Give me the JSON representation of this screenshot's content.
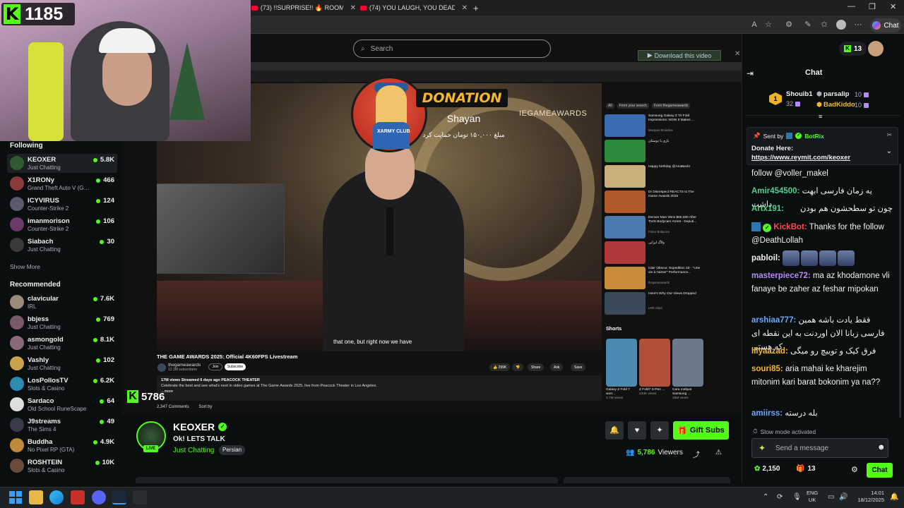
{
  "browser": {
    "tabs": [
      {
        "label": "(73) !!SURPRISE!! 🔥 ROOM TOUR"
      },
      {
        "label": "(74) YOU LAUGH, YOU DEAD! ❌"
      }
    ],
    "new_tab_icon": "plus-icon",
    "chat_button_label": "Chat",
    "search_placeholder": "Search",
    "download_button_label": "Download this video"
  },
  "webcam_overlay": {
    "kick_count": "1185"
  },
  "sidebar": {
    "following_heading": "Following",
    "following": [
      {
        "name": "KEOXER",
        "category": "Just Chatting",
        "viewers": "5.8K",
        "color": "#2f5a32"
      },
      {
        "name": "X1RONy",
        "category": "Grand Theft Auto V (G…",
        "viewers": "466",
        "color": "#8a3a3a"
      },
      {
        "name": "ICYVIRUS",
        "category": "Counter-Strike 2",
        "viewers": "124",
        "color": "#5a5a6a"
      },
      {
        "name": "imanmorison",
        "category": "Counter-Strike 2",
        "viewers": "106",
        "color": "#6a3a6a"
      },
      {
        "name": "Siabach",
        "category": "Just Chatting",
        "viewers": "30",
        "color": "#3a3a3a"
      }
    ],
    "show_more_label": "Show More",
    "recommended_heading": "Recommended",
    "recommended": [
      {
        "name": "clavicular",
        "category": "IRL",
        "viewers": "7.6K",
        "color": "#9a8a7a"
      },
      {
        "name": "bbjess",
        "category": "Just Chatting",
        "viewers": "769",
        "color": "#7a5a6a"
      },
      {
        "name": "asmongold",
        "category": "Just Chatting",
        "viewers": "8.1K",
        "color": "#8a6a7a"
      },
      {
        "name": "Vashly",
        "category": "Just Chatting",
        "viewers": "102",
        "color": "#c9a24a"
      },
      {
        "name": "LosPollosTV",
        "category": "Slots & Casino",
        "viewers": "6.2K",
        "color": "#2a8ab0"
      },
      {
        "name": "Sardaco",
        "category": "Old School RuneScape",
        "viewers": "64",
        "color": "#dddddd"
      },
      {
        "name": "J9streams",
        "category": "The Sims 4",
        "viewers": "49",
        "color": "#3a3a4a"
      },
      {
        "name": "Buddha",
        "category": "No Pixel RP (GTA)",
        "viewers": "4.9K",
        "color": "#c08a3a"
      },
      {
        "name": "ROSHTEIN",
        "category": "Slots & Casino",
        "viewers": "10K",
        "color": "#6a4a3a"
      }
    ]
  },
  "video": {
    "event_label": "IEGAMEAWARDS",
    "subtitle": "that one, but right now we have",
    "title": "THE GAME AWARDS 2025: Official 4K60FPS Livestream",
    "channel": "thegameawards",
    "channel_subs": "12.3M subscribers",
    "join_label": "Join",
    "subscribe_label": "Subscribe",
    "likes": "299K",
    "share_label": "Share",
    "ask_label": "Ask",
    "save_label": "Save",
    "description_line1": "17M views  Streamed 6 days ago  PEACOCK THEATER",
    "description_line2": "Celebrate the best and see what's next in video games at The Game Awards 2025, live from Peacock Theater in Los Angeles.",
    "description_more": "...more",
    "comments_label": "2,347 Comments",
    "sort_label": "Sort by",
    "filters": [
      "All",
      "From your search",
      "From thegameawards"
    ],
    "recommendations": [
      {
        "title": "Samsung Galaxy Z Tri Fold Impressions: NOW It Makes ...",
        "meta": "Marques Brownlee",
        "color": "#3a6ab0"
      },
      {
        "title": "بازی با دوستان",
        "meta": "",
        "color": "#2c8a3a"
      },
      {
        "title": "Happy birthday @AriaBeckr",
        "meta": "",
        "color": "#c9b07a"
      },
      {
        "title": "Dr Disrespect REACTS to The Game Awards 2025",
        "meta": "",
        "color": "#b05a2a"
      },
      {
        "title": "Denver Man Wins $80,000 After THIS Bodycam Arrest - Deputi...",
        "meta": "Police Bodycam",
        "color": "#4a7ab0"
      },
      {
        "title": "ولاگ ایرانی",
        "meta": "",
        "color": "#b03a3a"
      },
      {
        "title": "Clair Obscur: Expedition 33 - \"Une vie à t'aimer\" Performance...",
        "meta": "thegameawards",
        "color": "#c98a3a"
      },
      {
        "title": "Here's Why Our Views Dropped",
        "meta": "LMG Clips",
        "color": "#3a4a5a"
      }
    ],
    "shorts_label": "Shorts",
    "shorts": [
      {
        "title": "Galaxy Z Fold 7 wort...",
        "views": "3.7M views",
        "color": "#4a8ab0"
      },
      {
        "title": "Z Fold7 S-Pen ...",
        "views": "233K views",
        "color": "#b0503a"
      },
      {
        "title": "Cara melipat Samsung ...",
        "views": "28M views",
        "color": "#6a7a8a"
      }
    ]
  },
  "donation_alert": {
    "banner": "DONATION",
    "donor": "Shayan",
    "amount_text": "مبلغ ۱۵۰,۰۰۰ تومان حمایت کرد",
    "club_label": "XARMY CLUB"
  },
  "viewer_badge": {
    "count": "5786"
  },
  "stream": {
    "streamer": "KEOXER",
    "live_label": "LIVE",
    "title": "Ok! LETS TALK",
    "category": "Just Chatting",
    "tag": "Persian",
    "gift_subs_label": "Gift Subs",
    "viewers": "5,786",
    "viewers_label": "Viewers"
  },
  "chat": {
    "title": "Chat",
    "top_kicks": "13",
    "leaderboard": [
      {
        "rank": "1",
        "name": "Shouib1",
        "value": "32",
        "color": "#efeff1"
      },
      {
        "rank": "",
        "name": "parsalip",
        "value": "10",
        "color": "#efeff1"
      },
      {
        "rank": "",
        "name": "BadKiddo",
        "value": "10",
        "color": "#f5b82c"
      }
    ],
    "pinned": {
      "sent_by_label": "Sent by",
      "bot": "BotRix",
      "label": "Donate Here:",
      "link": "https://www.reymit.com/keoxer"
    },
    "messages": [
      {
        "user": "",
        "text": "follow @voller_makel",
        "color": "#efeff1"
      },
      {
        "user": "Amir454500:",
        "text": "یه زمان فارسی ابهت داشت",
        "color": "#53d18a"
      },
      {
        "user": "",
        "text": "چون تو سطحشون هم بودن",
        "color": "#efeff1"
      },
      {
        "user": "Artx191:",
        "text": "",
        "color": "#53d18a"
      },
      {
        "user": "KickBot:",
        "text": "Thanks for the follow @DeathLollah",
        "color": "#ff4a4a"
      },
      {
        "user": "pabloil:",
        "text": "",
        "color": "#efeff1"
      },
      {
        "user": "masterpiece72:",
        "text": "ma az khodamone vli fanaye be zaher az feshar mipokan",
        "color": "#b88af5"
      },
      {
        "user": "arshiaa777:",
        "text": "فقط یادت باشه همین فارسی زبانا الان اوردنت به این نقطه ای که هستی",
        "color": "#6aa8ff"
      },
      {
        "user": "lliyaazad:",
        "text": "فرق کیک و توییچ رو میگی",
        "color": "#f5b82c"
      },
      {
        "user": "souri85:",
        "text": "aria mahai ke kharejim mitonim kari barat bokonim ya na??",
        "color": "#f5b82c"
      },
      {
        "user": "amiirss:",
        "text": "بله درسته",
        "color": "#6aa8ff"
      }
    ],
    "slow_mode": "Slow mode activated",
    "placeholder": "Send a message",
    "kicks_balance": "2,150",
    "gift_balance": "13",
    "send_label": "Chat"
  },
  "taskbar": {
    "lang_top": "ENG",
    "lang_bottom": "UK",
    "time": "14:01",
    "date": "18/12/2025"
  },
  "colors": {
    "kick_green": "#53fc18",
    "background": "#0b0e0f"
  }
}
